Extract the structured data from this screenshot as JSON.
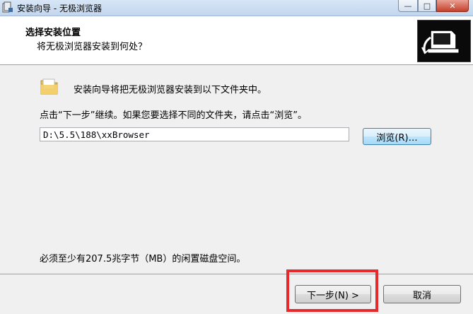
{
  "window": {
    "title": "安装向导 - 无极浏览器",
    "controls": {
      "minimize": "—",
      "maximize": "□",
      "close": "✕"
    }
  },
  "header": {
    "title": "选择安装位置",
    "subtitle": "将无极浏览器安装到何处？"
  },
  "body": {
    "intro_text": "安装向导将把无极浏览器安装到以下文件夹中。",
    "instruction_text": "点击“下一步”继续。如果您要选择不同的文件夹，请点击“浏览”。",
    "install_path": "D:\\5.5\\188\\xxBrowser",
    "browse_label": "浏览(R)…",
    "space_text": "必须至少有207.5兆字节（MB）的闲置磁盘空间。"
  },
  "footer": {
    "next_label": "下一步(N) >",
    "cancel_label": "取消"
  },
  "colors": {
    "highlight": "#e8282b",
    "panel_bg": "#f0f0f0"
  },
  "icons": [
    "installer-app-icon",
    "folder-icon",
    "computer-install-icon"
  ]
}
